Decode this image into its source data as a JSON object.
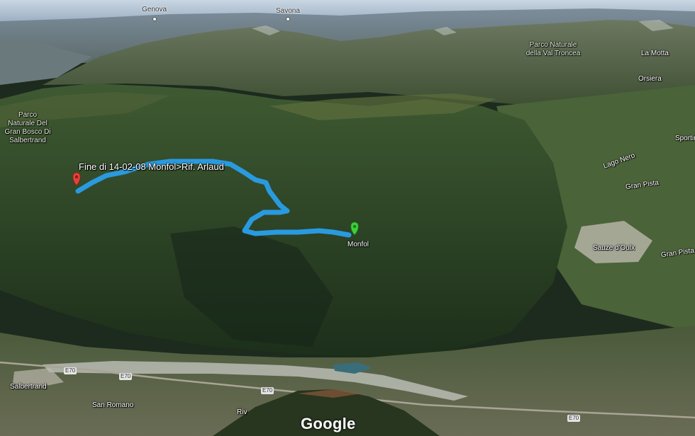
{
  "track": {
    "title": "Fine di 14-02-08 Monfol>Rif.  Arlaud",
    "start_label": "Monfol",
    "start_marker_color": "#3ccf3a",
    "end_marker_color": "#e0433a",
    "track_color": "#2a9ae0"
  },
  "places": {
    "genova": "Genova",
    "savona": "Savona",
    "park_val_troncea": "Parco Naturale della Val Troncea",
    "park_gran_bosco": "Parco Naturale Del Gran Bosco Di Salbertrand",
    "la_motta": "La Motta",
    "orsiera": "Orsiera",
    "sportinia": "Sportinia",
    "lago_nero": "Lago Nero",
    "gran_pista_1": "Gran Pista",
    "gran_pista_2": "Gran Pista",
    "sauze": "Sauze d'Oulx",
    "salbertrand": "Salbertrand",
    "san_romano": "San Romano",
    "rival": "Riv"
  },
  "roads": {
    "e70_a": "E70",
    "e70_b": "E70",
    "e70_c": "E70",
    "e70_d": "E70"
  },
  "brand": {
    "logo": "Google"
  }
}
